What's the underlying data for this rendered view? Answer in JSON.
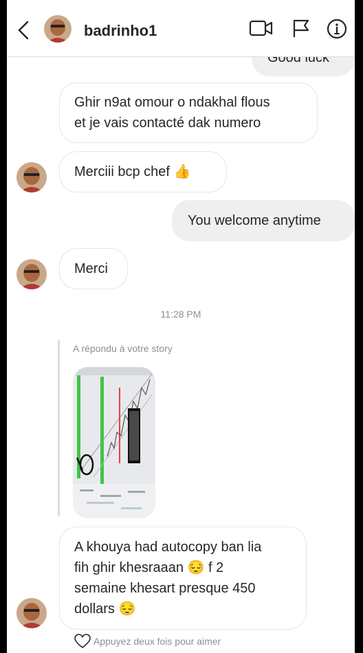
{
  "header": {
    "username": "badrinho1"
  },
  "messages": {
    "partial_top": "Good luck",
    "m1_line1": "Ghir n9at omour o ndakhal flous",
    "m1_line2": "et je vais contacté dak numero",
    "m2": "Merciii bcp chef",
    "m3": "You welcome anytime",
    "m4": "Merci",
    "timestamp": "11:28 PM",
    "story_reply_label": "A répondu à votre story",
    "m5_line1": "A khouya had autocopy ban lia",
    "m5_line2": "fih ghir khesraaan",
    "m5_line2b": "f 2",
    "m5_line3": "semaine khesart presque 450",
    "m5_line4": "dollars",
    "like_hint": "Appuyez deux fois pour aimer"
  },
  "icons": {
    "thumbs_up": "👍",
    "pensive": "😔"
  }
}
